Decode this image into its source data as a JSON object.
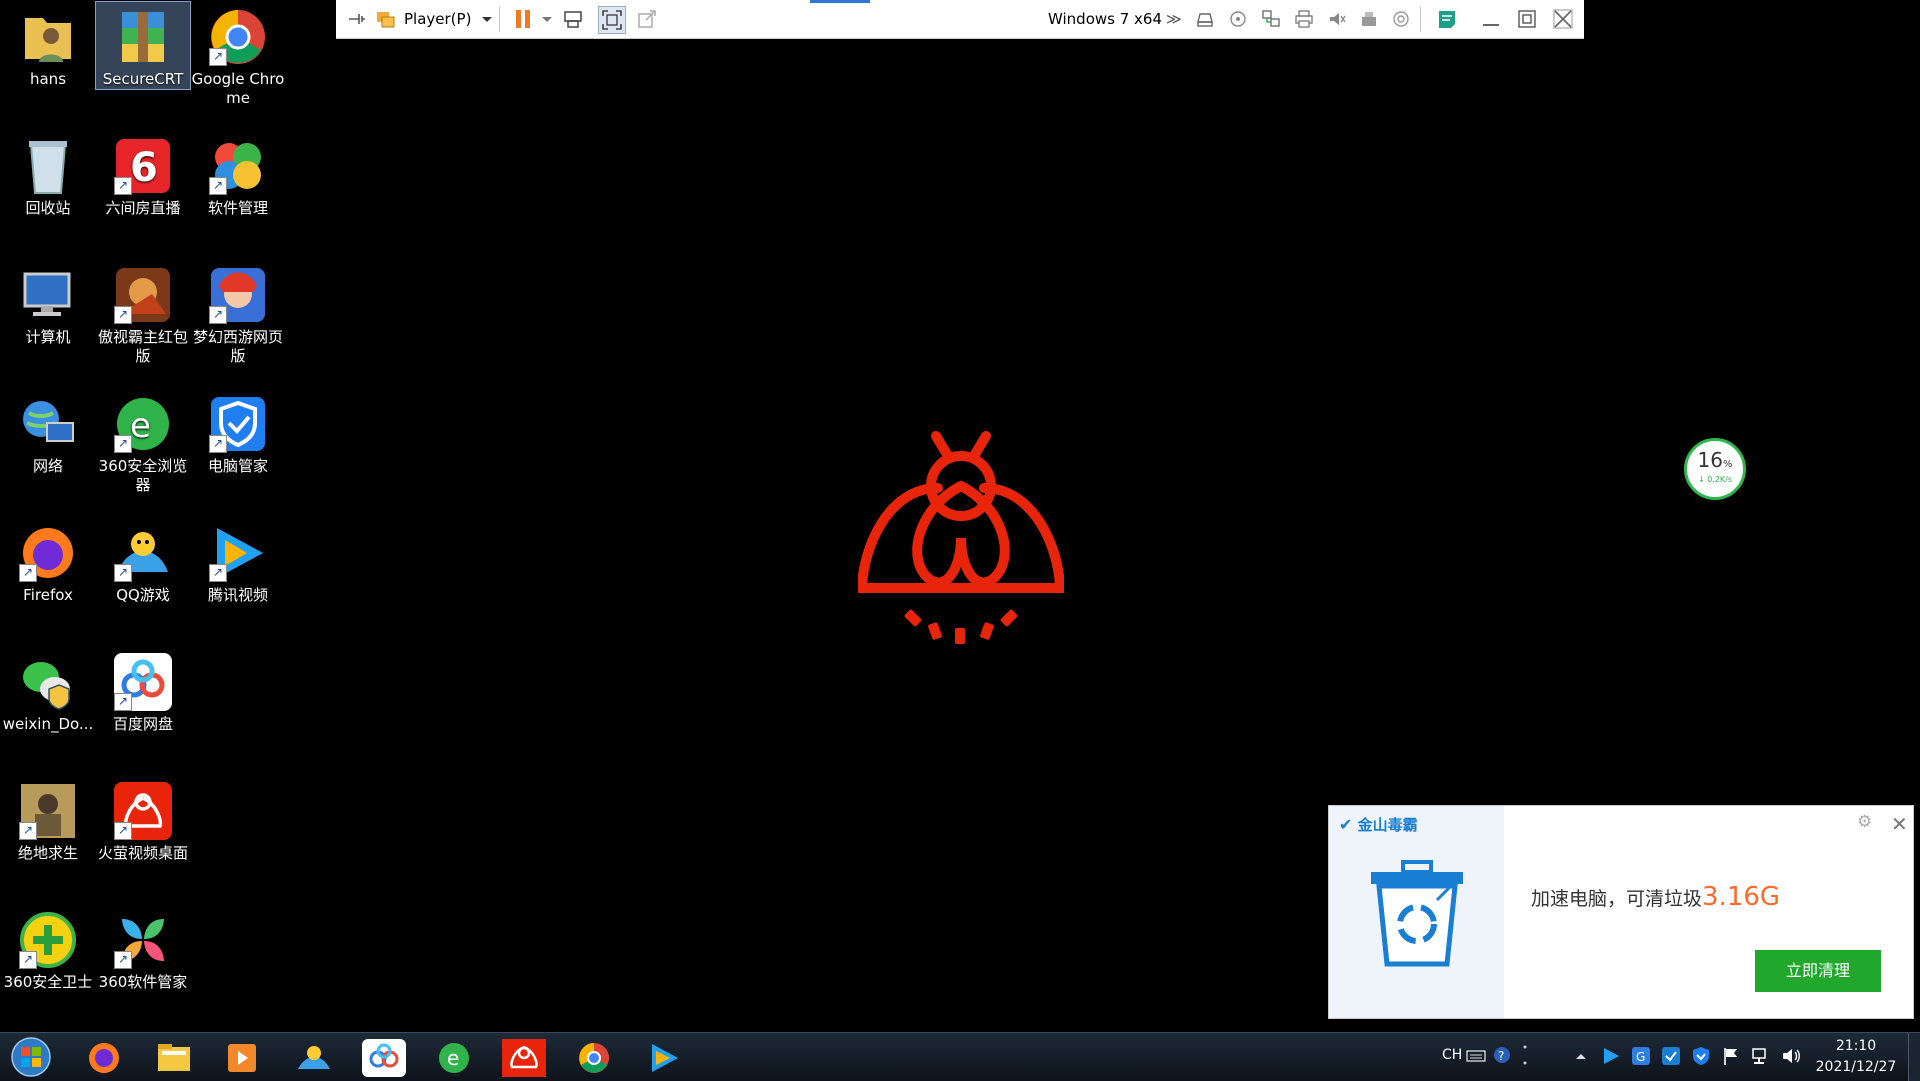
{
  "desktop_icons": [
    {
      "label": "hans",
      "icon": "user-folder-icon",
      "col": 0,
      "row": 0
    },
    {
      "label": "SecureCRT",
      "icon": "winrar-archive-icon",
      "col": 1,
      "row": 0,
      "selected": true
    },
    {
      "label": "Google Chrome",
      "icon": "chrome-icon",
      "col": 2,
      "row": 0,
      "shortcut": true
    },
    {
      "label": "回收站",
      "icon": "recycle-bin-icon",
      "col": 0,
      "row": 1
    },
    {
      "label": "六间房直播",
      "icon": "liujianfang-icon",
      "col": 1,
      "row": 1,
      "shortcut": true
    },
    {
      "label": "软件管理",
      "icon": "software-manager-icon",
      "col": 2,
      "row": 1,
      "shortcut": true
    },
    {
      "label": "计算机",
      "icon": "computer-icon",
      "col": 0,
      "row": 2
    },
    {
      "label": "傲视霸主红包版",
      "icon": "game-aoshi-icon",
      "col": 1,
      "row": 2,
      "shortcut": true
    },
    {
      "label": "梦幻西游网页版",
      "icon": "game-menghuan-icon",
      "col": 2,
      "row": 2,
      "shortcut": true
    },
    {
      "label": "网络",
      "icon": "network-icon",
      "col": 0,
      "row": 3
    },
    {
      "label": "360安全浏览器",
      "icon": "360-browser-icon",
      "col": 1,
      "row": 3,
      "shortcut": true
    },
    {
      "label": "电脑管家",
      "icon": "tencent-pc-manager-icon",
      "col": 2,
      "row": 3,
      "shortcut": true
    },
    {
      "label": "Firefox",
      "icon": "firefox-icon",
      "col": 0,
      "row": 4,
      "shortcut": true
    },
    {
      "label": "QQ游戏",
      "icon": "qq-game-icon",
      "col": 1,
      "row": 4,
      "shortcut": true
    },
    {
      "label": "腾讯视频",
      "icon": "tencent-video-icon",
      "col": 2,
      "row": 4,
      "shortcut": true
    },
    {
      "label": "weixin_Do...",
      "icon": "wechat-installer-icon",
      "col": 0,
      "row": 5
    },
    {
      "label": "百度网盘",
      "icon": "baidu-netdisk-icon",
      "col": 1,
      "row": 5,
      "shortcut": true
    },
    {
      "label": "绝地求生",
      "icon": "pubg-icon",
      "col": 0,
      "row": 6,
      "shortcut": true
    },
    {
      "label": "火萤视频桌面",
      "icon": "firefly-video-icon",
      "col": 1,
      "row": 6,
      "shortcut": true
    },
    {
      "label": "360安全卫士",
      "icon": "360-safe-icon",
      "col": 0,
      "row": 7,
      "shortcut": true
    },
    {
      "label": "360软件管家",
      "icon": "360-software-icon",
      "col": 1,
      "row": 7,
      "shortcut": true
    }
  ],
  "vm_toolbar": {
    "player_label": "Player(P)",
    "vm_name": "Windows 7 x64",
    "more": "≫"
  },
  "speed_ball": {
    "percent": "16",
    "percent_unit": "%",
    "rate": "↓ 0.2K/s"
  },
  "popup": {
    "brand": "金山毒霸",
    "message": "加速电脑，可清垃圾",
    "size": "3.16G",
    "button": "立即清理"
  },
  "taskbar": {
    "lang": "CH",
    "time": "21:10",
    "date": "2021/12/27"
  },
  "colors": {
    "firefly_red": "#e8250a",
    "clean_green": "#22a72d",
    "accent_blue": "#1a7fd3"
  }
}
